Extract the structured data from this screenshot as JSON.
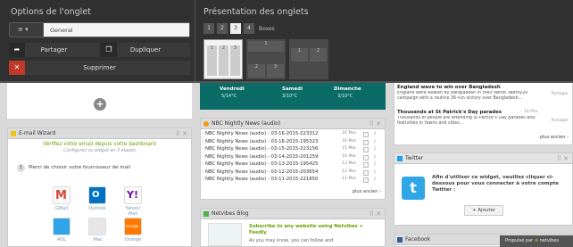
{
  "tab_options": {
    "title": "Options de l'onglet",
    "name_value": "General",
    "share_label": "Partager",
    "duplicate_label": "Dupliquer",
    "delete_label": "Supprimer"
  },
  "presentation": {
    "title": "Présentation des onglets",
    "columns": [
      "1",
      "2",
      "3",
      "4"
    ],
    "active_column": "3",
    "boxes_label": "Boxes",
    "layout_labels": [
      "1",
      "2",
      "3",
      "1",
      "2",
      "3",
      "1",
      "2"
    ]
  },
  "weather": {
    "days": [
      {
        "day": "Vendredi",
        "temp": "5/14°C"
      },
      {
        "day": "Samedi",
        "temp": "3/10°C"
      },
      {
        "day": "Dimanche",
        "temp": "3/10°C"
      }
    ]
  },
  "email_wizard": {
    "title": "E-mail Wizard",
    "headline": "Vérifiez votre email depuis votre dashboard",
    "sub": "Configurez ce widget en 3 étapes",
    "step_num": "1",
    "step_text": "Merci de choisir votre fournisseur de mail",
    "providers": [
      "GMail",
      "Outlook",
      "Yahoo! Mail",
      "AOL",
      ".Mac",
      "Orange"
    ]
  },
  "nbc": {
    "title": "NBC Nightly News (audio)",
    "items": [
      {
        "title": "NBC Nightly News (audio) - 03-16-2015-223312",
        "date": "16 Mar"
      },
      {
        "title": "NBC Nightly News (audio) - 03-16-2015-195323",
        "date": "16 Mar"
      },
      {
        "title": "NBC Nightly News (audio) - 03-15-2015-223156",
        "date": "15 Mar"
      },
      {
        "title": "NBC Nightly News (audio) - 03-14-2015-201259",
        "date": "14 Mar"
      },
      {
        "title": "NBC Nightly News (audio) - 03-13-2015-195425",
        "date": "13 Mar"
      },
      {
        "title": "NBC Nightly News (audio) - 03-12-2015-203654",
        "date": "12 Mar"
      },
      {
        "title": "NBC Nightly News (audio) - 03-11-2015-221850",
        "date": "11 Mar"
      }
    ],
    "more": "plus ancien"
  },
  "netvibes_blog": {
    "title": "Netvibes Blog",
    "text_1": "Subscribe to any website using Netvibes +",
    "text_2": "Feedly",
    "text_3": "As you may know, you can follow and"
  },
  "news": {
    "item_1": {
      "title": "England wave to win over Bangladesh",
      "text": "England were beaten by Bangladesh in their World Twenty20 campaign with a routine 36-run victory over Bangladesh...",
      "action": "Partager"
    },
    "item_2": {
      "title": "Thousands at St Patrick's Day parades",
      "date": "16 Mar",
      "text": "Thousands of people are attending St Patrick's Day parades and festivities in towns and cities...",
      "action": "Partager"
    },
    "more": "plus ancien"
  },
  "twitter": {
    "title": "Twitter",
    "text": "Afin d'utiliser ce widget, veuillez cliquer ci-dessous pour vous connecter à votre compte Twitter :",
    "add_label": "+ Ajouter"
  },
  "facebook": {
    "title": "Facebook"
  },
  "footer": {
    "text": "Propulsé par",
    "brand": "netvibes"
  },
  "colors": {
    "weather_teal": "#0b6b66",
    "email_green": "#6a9e00",
    "twitter_blue": "#1da1f2",
    "overlay_bg": "#2a2a2a",
    "delete_red": "#c0392b"
  }
}
